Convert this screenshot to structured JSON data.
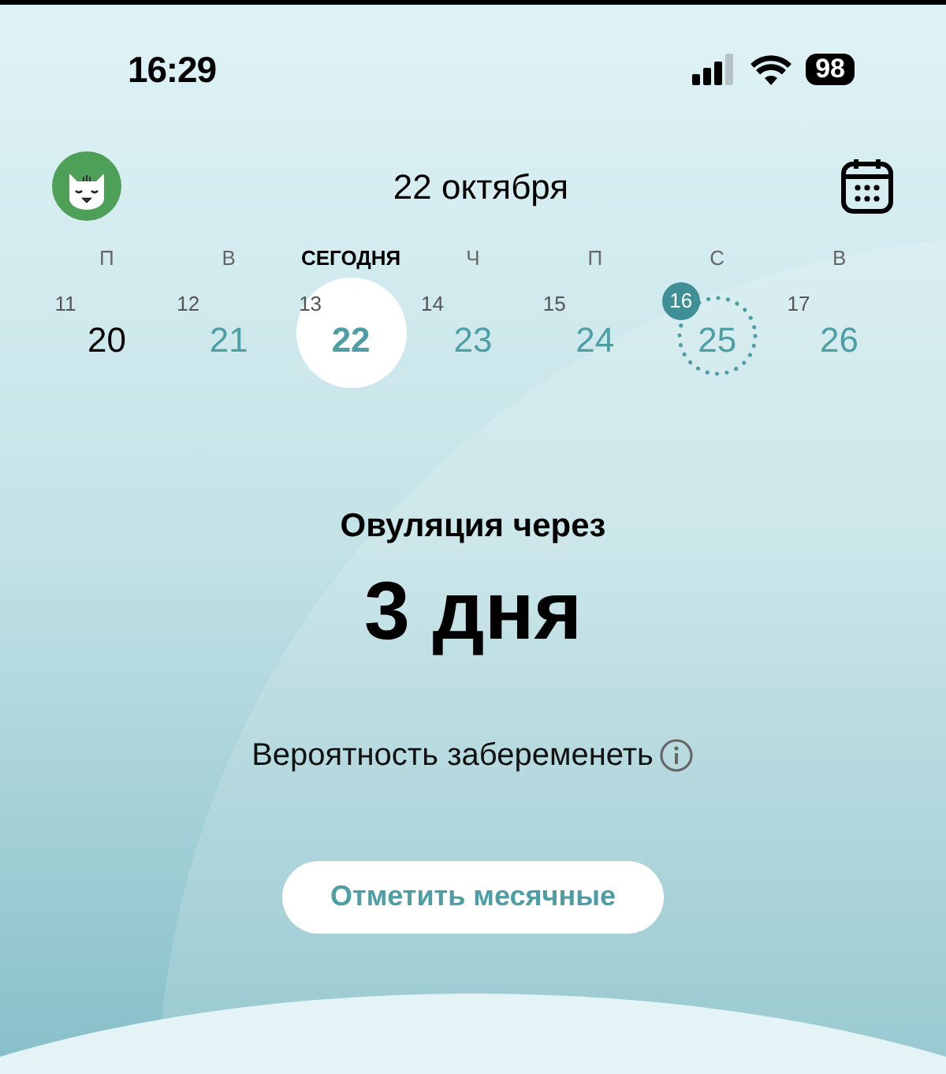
{
  "status_bar": {
    "time": "16:29",
    "battery": "98"
  },
  "header": {
    "date": "22 октября"
  },
  "week": [
    {
      "weekday": "П",
      "cycle_day": "11",
      "date": "20",
      "kind": "past",
      "selected": false
    },
    {
      "weekday": "В",
      "cycle_day": "12",
      "date": "21",
      "kind": "future",
      "selected": false
    },
    {
      "weekday": "СЕГОДНЯ",
      "cycle_day": "13",
      "date": "22",
      "kind": "today",
      "selected": true
    },
    {
      "weekday": "Ч",
      "cycle_day": "14",
      "date": "23",
      "kind": "future",
      "selected": false
    },
    {
      "weekday": "П",
      "cycle_day": "15",
      "date": "24",
      "kind": "future",
      "selected": false
    },
    {
      "weekday": "С",
      "cycle_day": "16",
      "date": "25",
      "kind": "ovulation",
      "selected": false
    },
    {
      "weekday": "В",
      "cycle_day": "17",
      "date": "26",
      "kind": "future",
      "selected": false
    }
  ],
  "forecast": {
    "title": "Овуляция через",
    "value": "3 дня",
    "probability": "Вероятность забеременеть"
  },
  "action_button": "Отметить месячные"
}
